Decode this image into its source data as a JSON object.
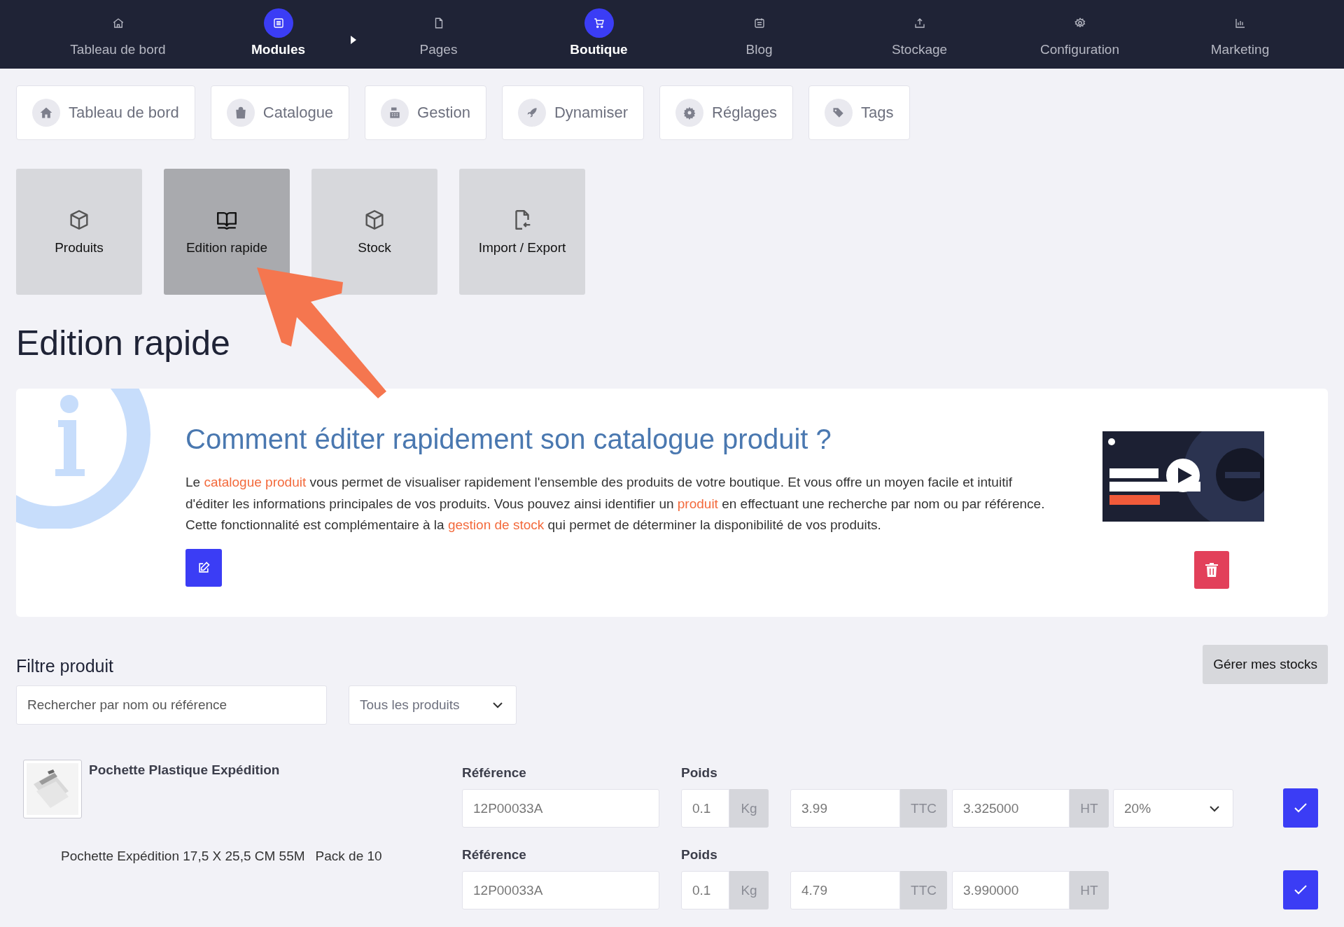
{
  "top_nav": [
    {
      "label": "Tableau de bord",
      "kind": "home",
      "active": false,
      "expanded": false
    },
    {
      "label": "Modules",
      "kind": "list",
      "active": true,
      "expanded": true
    },
    {
      "label": "Pages",
      "kind": "page",
      "active": false,
      "expanded": false
    },
    {
      "label": "Boutique",
      "kind": "cart",
      "active": true,
      "expanded": false
    },
    {
      "label": "Blog",
      "kind": "calendar",
      "active": false,
      "expanded": false
    },
    {
      "label": "Stockage",
      "kind": "upload",
      "active": false,
      "expanded": false
    },
    {
      "label": "Configuration",
      "kind": "gear",
      "active": false,
      "expanded": false
    },
    {
      "label": "Marketing",
      "kind": "chart",
      "active": false,
      "expanded": false
    }
  ],
  "sub_tabs": [
    {
      "label": "Tableau de bord",
      "kind": "home"
    },
    {
      "label": "Catalogue",
      "kind": "bag"
    },
    {
      "label": "Gestion",
      "kind": "register"
    },
    {
      "label": "Dynamiser",
      "kind": "rocket"
    },
    {
      "label": "Réglages",
      "kind": "gear"
    },
    {
      "label": "Tags",
      "kind": "tags"
    }
  ],
  "tiles": [
    {
      "label": "Produits",
      "kind": "box",
      "selected": false
    },
    {
      "label": "Edition rapide",
      "kind": "book",
      "selected": true
    },
    {
      "label": "Stock",
      "kind": "box",
      "selected": false
    },
    {
      "label": "Import / Export",
      "kind": "file",
      "selected": false
    }
  ],
  "page_title": "Edition rapide",
  "info": {
    "title": "Comment éditer rapidement son catalogue produit ?",
    "body": [
      {
        "kind": "text",
        "text": "Le "
      },
      {
        "kind": "link",
        "text": "catalogue produit"
      },
      {
        "kind": "text",
        "text": " vous permet de visualiser rapidement l'ensemble des produits de votre boutique. Et vous offre un moyen facile et intuitif d'éditer les informations principales de vos produits. Vous pouvez ainsi identifier un "
      },
      {
        "kind": "link",
        "text": "produit"
      },
      {
        "kind": "text",
        "text": " en effectuant une recherche par nom ou par référence. Cette fonctionnalité est complémentaire à la "
      },
      {
        "kind": "link",
        "text": "gestion de stock"
      },
      {
        "kind": "text",
        "text": " qui permet de déterminer la disponibilité de vos produits."
      }
    ]
  },
  "filter": {
    "title": "Filtre produit",
    "search_placeholder": "Rechercher par nom ou référence",
    "select_value": "Tous les produits",
    "stock_button": "Gérer mes stocks"
  },
  "products": [
    {
      "name": "Pochette Plastique Expédition",
      "variants": [
        {
          "reference_label": "Référence",
          "reference": "12P00033A",
          "weight_label": "Poids",
          "weight": "0.1",
          "weight_unit": "Kg",
          "price_ttc": "3.99",
          "ttc_label": "TTC",
          "price_ht": "3.325000",
          "ht_label": "HT",
          "vat": "20%"
        },
        {
          "description": "Pochette Expédition 17,5 X 25,5 CM 55M",
          "pack": "Pack de 10",
          "reference_label": "Référence",
          "reference": "12P00033A",
          "weight_label": "Poids",
          "weight": "0.1",
          "weight_unit": "Kg",
          "price_ttc": "4.79",
          "ttc_label": "TTC",
          "price_ht": "3.990000",
          "ht_label": "HT"
        }
      ]
    }
  ]
}
